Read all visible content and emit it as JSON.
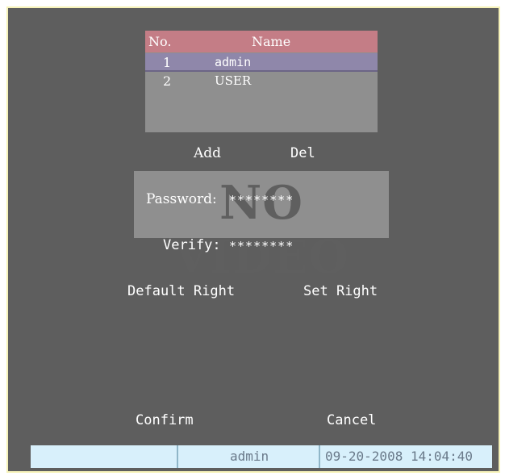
{
  "user_list": {
    "headers": {
      "no": "No.",
      "name": "Name"
    },
    "rows": [
      {
        "no": "1",
        "name": "admin"
      },
      {
        "no": "2",
        "name": "USER"
      }
    ]
  },
  "actions": {
    "add": "Add",
    "del": "Del"
  },
  "video_overlay": "NO VIDEO",
  "password": {
    "label": "Password:",
    "value": "********"
  },
  "verify": {
    "label": "Verify:",
    "value": "********"
  },
  "rights": {
    "default": "Default Right",
    "set": "Set Right"
  },
  "dialog": {
    "confirm": "Confirm",
    "cancel": "Cancel"
  },
  "status_bar": {
    "user": "admin",
    "datetime": "09-20-2008 14:04:40"
  },
  "colors": {
    "background": "#5e5e5e",
    "header": "#c47d86",
    "selected_row": "#8f87aa",
    "status_bar": "#d8f0fb"
  }
}
